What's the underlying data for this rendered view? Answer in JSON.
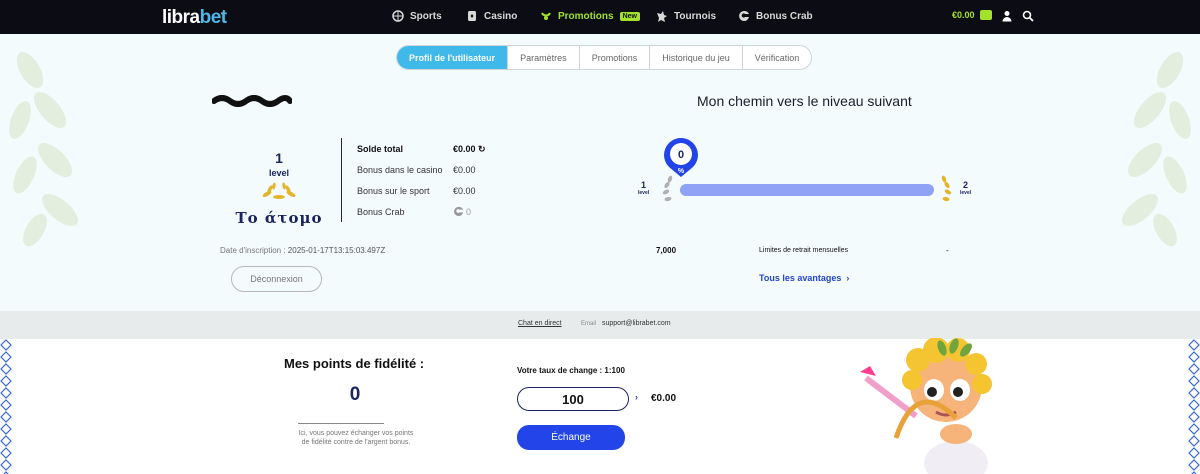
{
  "header": {
    "logo_main": "libra",
    "logo_accent": "bet",
    "nav": [
      {
        "label": "Sports",
        "icon": "sports-ball-icon"
      },
      {
        "label": "Casino",
        "icon": "casino-card-icon"
      },
      {
        "label": "Promotions",
        "icon": "promotions-icon",
        "badge": "New"
      },
      {
        "label": "Tournois",
        "icon": "tournament-icon"
      },
      {
        "label": "Bonus Crab",
        "icon": "crab-icon"
      }
    ],
    "balance": "€0.00",
    "icons": [
      "wallet-icon",
      "user-icon",
      "search-icon"
    ]
  },
  "tabs": [
    {
      "label": "Profil de l'utilisateur",
      "active": true
    },
    {
      "label": "Paramètres",
      "active": false
    },
    {
      "label": "Promotions",
      "active": false
    },
    {
      "label": "Historique du jeu",
      "active": false
    },
    {
      "label": "Vérification",
      "active": false
    }
  ],
  "profile": {
    "level_number": "1",
    "level_word": "level",
    "level_name": "Το άτομο",
    "balances": [
      {
        "label": "Solde total",
        "value": "€0.00"
      },
      {
        "label": "Bonus dans le casino",
        "value": "€0.00"
      },
      {
        "label": "Bonus sur le sport",
        "value": "€0.00"
      },
      {
        "label": "Bonus Crab",
        "value": "0"
      }
    ],
    "registration_label": "Date d'inscription :",
    "registration_value": "2025-01-17T13:15:03.497Z",
    "logout_label": "Déconnexion"
  },
  "progress": {
    "title": "Mon chemin vers le niveau suivant",
    "marker_value": "0",
    "marker_symbol": "%",
    "current_level": "1",
    "next_level": "2",
    "level_word": "level",
    "progress_fraction": 0,
    "withdraw_value": "7,000",
    "withdraw_label": "Limites de retrait mensuelles",
    "withdraw_dash": "-",
    "advantages_label": "Tous les avantages",
    "advantages_arrow": "›"
  },
  "support": {
    "chat_label": "Chat en direct",
    "email_label": "Email",
    "email_value": "support@librabet.com"
  },
  "loyalty": {
    "title": "Mes points de fidélité :",
    "points": "0",
    "description": "Ici, vous pouvez échanger vos points de fidélité contre de l'argent bonus.",
    "rate_label": "Votre taux de change : 1:100",
    "input_value": "100",
    "arrow": "›",
    "exchange_result": "€0.00",
    "exchange_button": "Échange"
  },
  "colors": {
    "accent": "#3fb9ea",
    "promo_green": "#a4e22a",
    "navy": "#1a2460",
    "button_blue": "#2344e8",
    "progress_fill": "#8fa2f5"
  }
}
